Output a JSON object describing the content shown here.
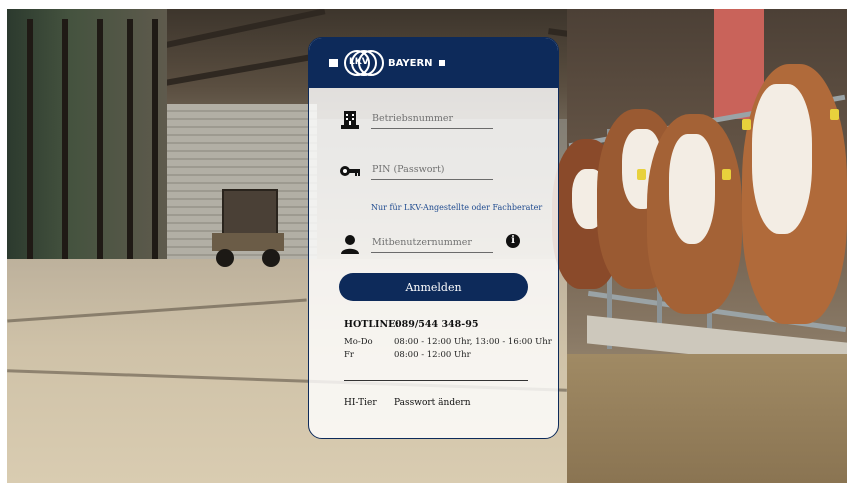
{
  "header": {
    "logo_text": "LKV",
    "brand": "BAYERN"
  },
  "form": {
    "betriebsnummer_placeholder": "Betriebsnummer",
    "pin_placeholder": "PIN (Passwort)",
    "hint_link": "Nur für LKV-Angestellte oder Fachberater",
    "mitbenutzer_placeholder": "Mitbenutzernummer",
    "info_icon": "i",
    "login_button": "Anmelden"
  },
  "hotline": {
    "label": "HOTLINE:",
    "number": "089/544 348-95",
    "hours": [
      {
        "day": "Mo-Do",
        "time": "08:00 - 12:00 Uhr, 13:00 - 16:00 Uhr"
      },
      {
        "day": "Fr",
        "time": "08:00 - 12:00 Uhr"
      }
    ]
  },
  "footer": {
    "hitier": "HI-Tier",
    "password_link": "Passwort ändern"
  },
  "icons": {
    "building": "building-icon",
    "key": "key-icon",
    "user": "user-icon",
    "info": "info-icon"
  },
  "colors": {
    "primary": "#0d2a5a",
    "link": "#1f4b8f"
  }
}
